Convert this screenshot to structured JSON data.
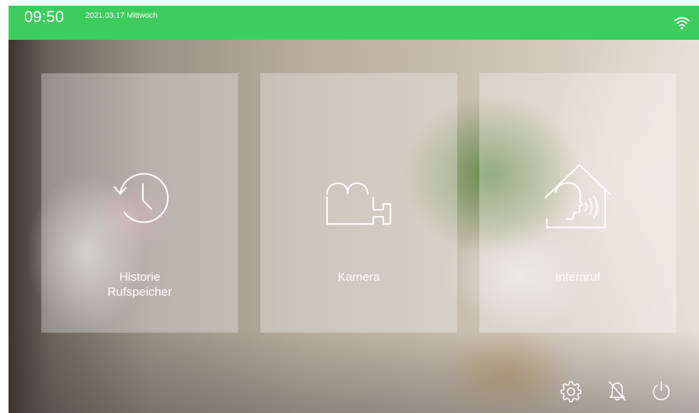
{
  "statusbar": {
    "time": "09:50",
    "date": "2021.03.17 Mittwoch",
    "color": "#3dcd5c",
    "wifi_icon": "wifi-icon"
  },
  "tiles": [
    {
      "label_line1": "Historie",
      "label_line2": "Rufspeicher",
      "icon": "history-clock-icon"
    },
    {
      "label": "Kamera",
      "icon": "movie-camera-icon"
    },
    {
      "label": "Internruf",
      "icon": "house-intercom-icon"
    }
  ],
  "bottom_bar": {
    "icons": [
      "settings-gear-icon",
      "bell-off-icon",
      "power-icon"
    ]
  }
}
